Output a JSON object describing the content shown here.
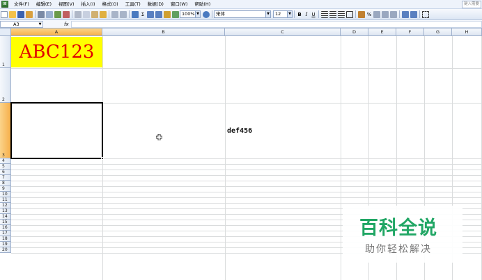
{
  "menubar": {
    "items": [
      "文件(F)",
      "编辑(E)",
      "视图(V)",
      "插入(I)",
      "格式(O)",
      "工具(T)",
      "数据(D)",
      "窗口(W)",
      "帮助(H)"
    ],
    "help_box": "键入需要"
  },
  "toolbar": {
    "zoom": "100%",
    "font_name": "宋体",
    "font_size": "12",
    "bold": "B",
    "italic": "I",
    "underline": "U",
    "percent": "%",
    "sigma": "Σ"
  },
  "formula_bar": {
    "name_box": "A3",
    "fx": "fx",
    "formula": ""
  },
  "sheet": {
    "columns": [
      "A",
      "B",
      "C",
      "D",
      "E",
      "F",
      "G",
      "H"
    ],
    "rows": [
      "1",
      "2",
      "3",
      "4",
      "5",
      "6",
      "7",
      "8",
      "9",
      "10",
      "11",
      "12",
      "13",
      "14",
      "15",
      "16",
      "17",
      "18",
      "19",
      "20"
    ],
    "selected_cell": "A3",
    "cells": {
      "A1": "ABC123",
      "C3": "def456"
    },
    "colors": {
      "a1_fill": "#ffff00",
      "a1_text": "#e00000",
      "header_selected": "#f6b04c"
    }
  },
  "watermark": {
    "title": "百科全说",
    "subtitle": "助你轻松解决",
    "color": "#20a664"
  }
}
